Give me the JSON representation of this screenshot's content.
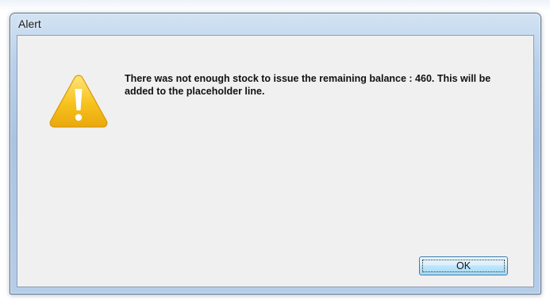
{
  "dialog": {
    "title": "Alert",
    "message": "There was not enough stock to issue the remaining balance : 460. This will be added to the placeholder line.",
    "icon": "warning-icon",
    "ok_label": "OK"
  },
  "colors": {
    "icon_fill": "#f7c21c",
    "button_border": "#3c7fb1"
  }
}
